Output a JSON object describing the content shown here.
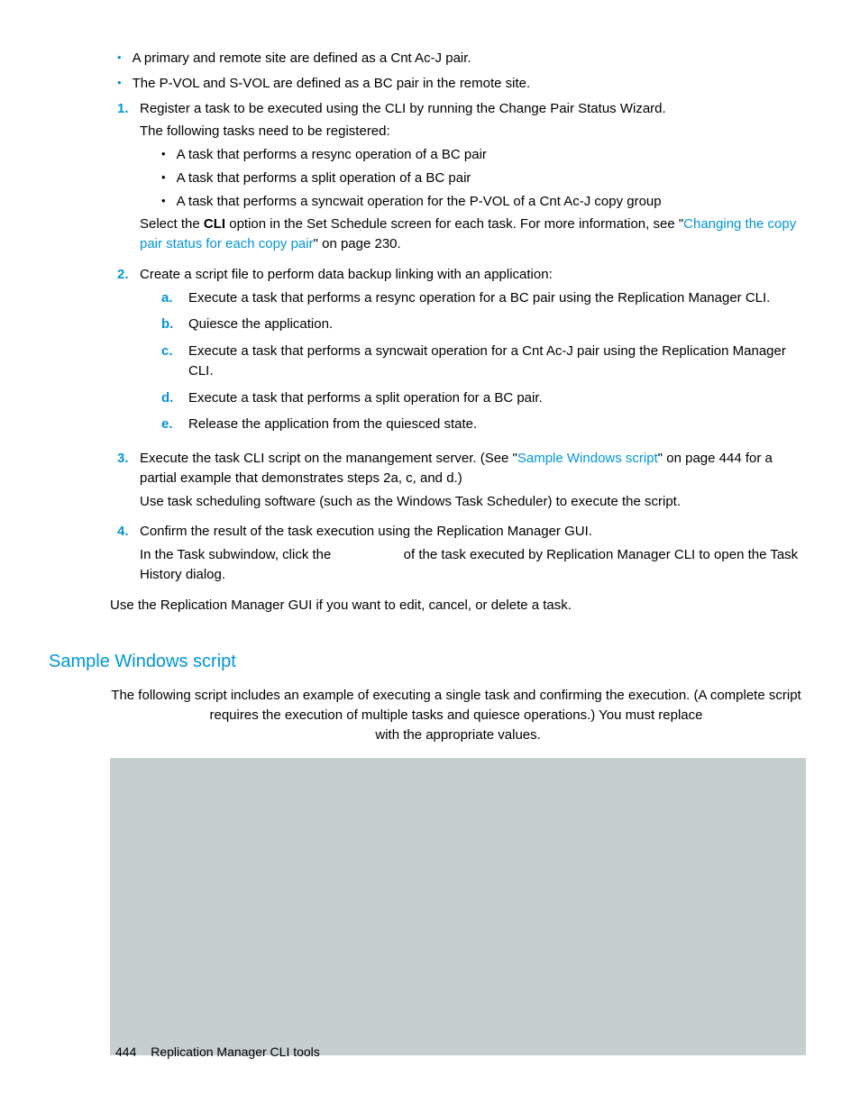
{
  "bullets": [
    "A primary and remote site are defined as a Cnt Ac-J pair.",
    "The P-VOL and S-VOL are defined as a BC pair in the remote site."
  ],
  "steps": {
    "1": {
      "lead": "Register a task to be executed using the CLI by running the Change Pair Status Wizard.",
      "p2": "The following tasks need to be registered:",
      "subs": [
        "A task that performs a resync operation of a BC pair",
        "A task that performs a split operation of a BC pair",
        "A task that performs a syncwait operation for the P-VOL of a Cnt Ac-J copy group"
      ],
      "tail_pre": "Select the ",
      "tail_bold": "CLI",
      "tail_mid": " option in the Set Schedule screen for each task. For more information, see \"",
      "tail_link": "Changing the copy pair status for each copy pair",
      "tail_post": "\" on page 230."
    },
    "2": {
      "lead": "Create a script file to perform data backup linking with an application:",
      "a": "Execute a task that performs a resync operation for a BC pair using the Replication Manager CLI.",
      "b": "Quiesce the application.",
      "c": "Execute a task that performs a syncwait operation for a Cnt Ac-J pair using the Replication Manager CLI.",
      "d": "Execute a task that performs a split operation for a BC pair.",
      "e": "Release the application from the quiesced state."
    },
    "3": {
      "pre": "Execute the task CLI script on the manangement server. (See \"",
      "link": "Sample Windows script",
      "post": "\" on page 444 for a partial example that demonstrates steps 2a, c, and d.)",
      "p2": "Use task scheduling software (such as the Windows Task Scheduler) to execute the script."
    },
    "4": {
      "lead": "Confirm the result of the task execution using the Replication Manager GUI.",
      "p2_a": "In the Task subwindow, click the ",
      "p2_b": " of the task executed by Replication Manager CLI to open the Task History dialog."
    }
  },
  "after": "Use the Replication Manager GUI if you want to edit, cancel, or delete a task.",
  "heading": "Sample Windows script",
  "section_p1": "The following script includes an example of executing a single task and confirming the execution. (A complete script requires the execution of multiple tasks and quiesce operations.) You must replace",
  "section_p2": " with the appropriate values.",
  "footer_page": "444",
  "footer_title": "Replication Manager CLI tools"
}
